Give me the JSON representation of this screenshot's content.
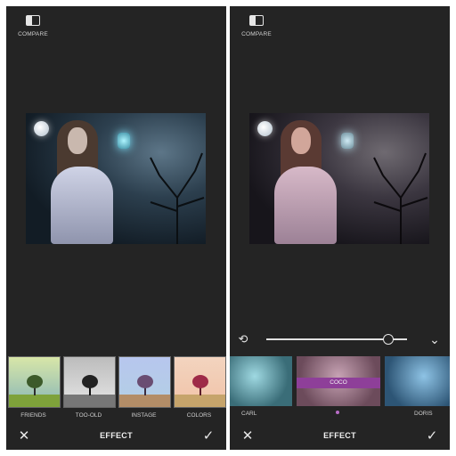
{
  "left_screen": {
    "compare_label": "COMPARE",
    "thumbnails": [
      {
        "label": "FRIENDS"
      },
      {
        "label": "TOO-OLD"
      },
      {
        "label": "INSTAGE"
      },
      {
        "label": "COLORS"
      }
    ],
    "bottom_bar": {
      "title": "EFFECT",
      "close_icon": "close-icon",
      "apply_icon": "check-icon"
    }
  },
  "right_screen": {
    "compare_label": "COMPARE",
    "slider": {
      "value": 0.87,
      "reset_icon": "reset-icon",
      "collapse_icon": "chevron-down-icon"
    },
    "effects": [
      {
        "label": "CARL"
      },
      {
        "label": "COCO",
        "selected": true
      },
      {
        "label": "DORIS"
      }
    ],
    "bottom_bar": {
      "title": "EFFECT",
      "close_icon": "close-icon",
      "apply_icon": "check-icon"
    }
  },
  "colors": {
    "background": "#242424",
    "accent": "#8e3f99"
  }
}
